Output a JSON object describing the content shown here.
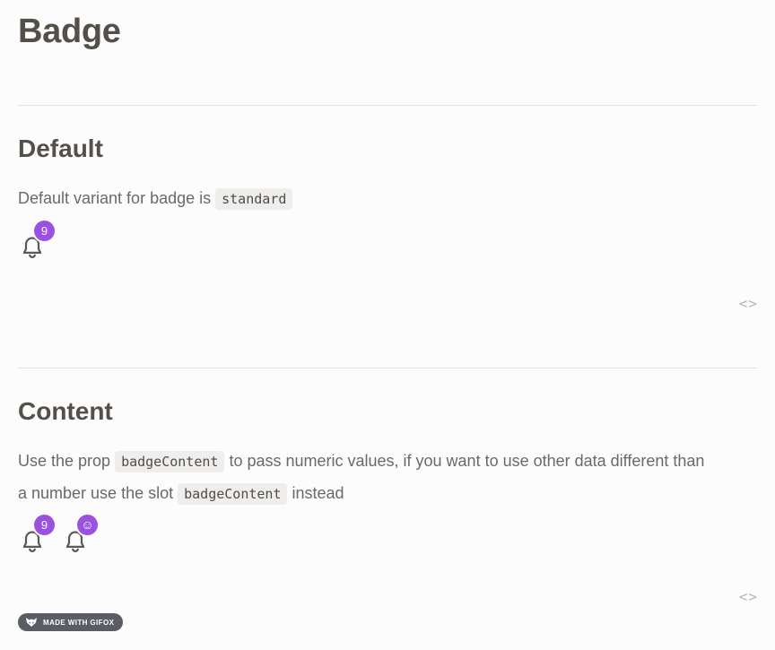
{
  "page": {
    "title": "Badge"
  },
  "sections": [
    {
      "heading": "Default",
      "text_before": "Default variant for badge is ",
      "code": "standard",
      "badges": [
        {
          "content": "9"
        }
      ],
      "code_toggle": "<>"
    },
    {
      "heading": "Content",
      "text_1": "Use the prop ",
      "code_1": "badgeContent",
      "text_2": " to pass numeric values, if you want to use other data different than a number use the slot ",
      "code_2": "badgeContent",
      "text_3": " instead",
      "badges": [
        {
          "content": "9"
        },
        {
          "content": "☺"
        }
      ],
      "code_toggle": "<>"
    }
  ],
  "watermark": {
    "label": "MADE WITH GIFOX"
  },
  "colors": {
    "badge": "#9b51e0",
    "text": "#6b6963",
    "heading": "#545049"
  },
  "icons": {
    "notification": "bell-icon",
    "watermark": "fox-icon",
    "toggle": "code-icon"
  }
}
